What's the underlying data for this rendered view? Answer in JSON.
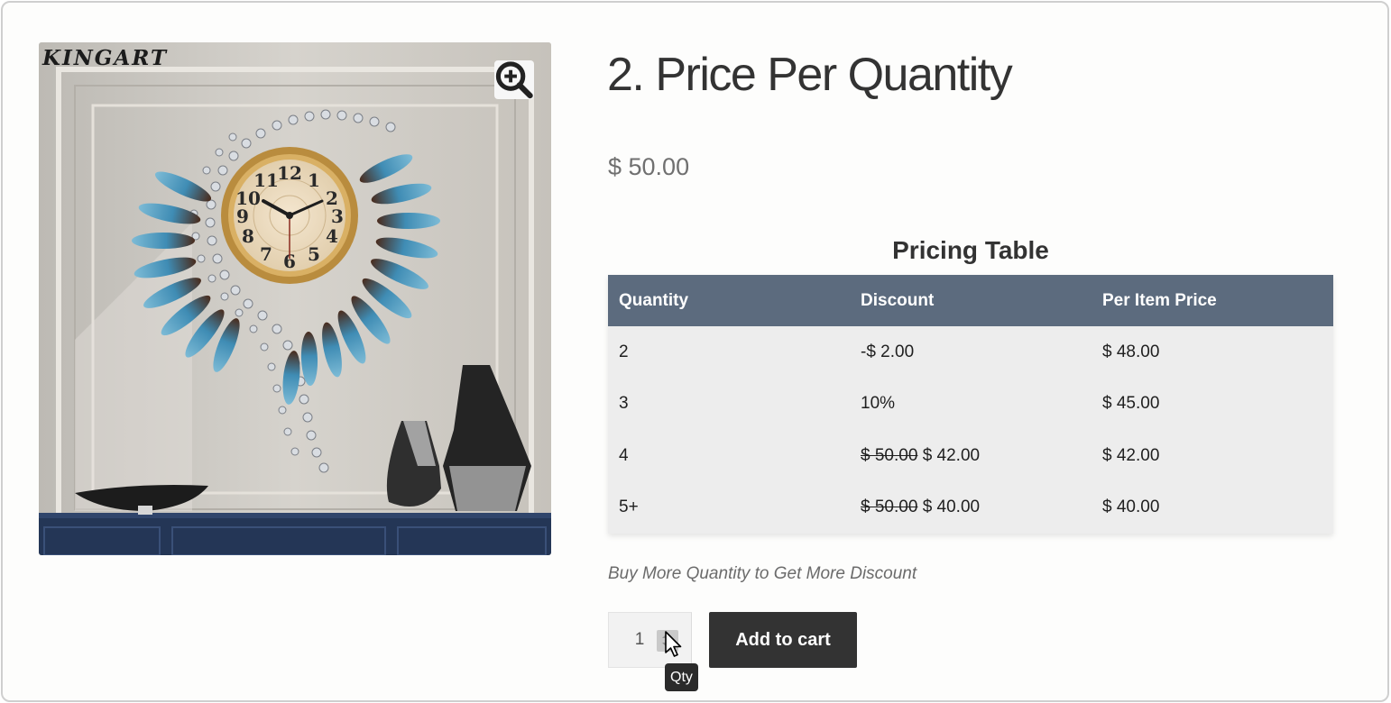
{
  "product": {
    "title": "2. Price Per Quantity",
    "price": "$ 50.00",
    "image": {
      "brand_mark": "KINGART",
      "zoom_icon": "zoom-in-icon"
    }
  },
  "pricing_table": {
    "title": "Pricing Table",
    "columns": [
      "Quantity",
      "Discount",
      "Per Item Price"
    ],
    "rows": [
      {
        "quantity": "2",
        "discount_old": "",
        "discount": "-$ 2.00",
        "per_item": "$ 48.00"
      },
      {
        "quantity": "3",
        "discount_old": "",
        "discount": "10%",
        "per_item": "$ 45.00"
      },
      {
        "quantity": "4",
        "discount_old": "$ 50.00",
        "discount": "$ 42.00",
        "per_item": "$ 42.00"
      },
      {
        "quantity": "5+",
        "discount_old": "$ 50.00",
        "discount": "$ 40.00",
        "per_item": "$ 40.00"
      }
    ]
  },
  "note": "Buy More Quantity to Get More Discount",
  "cart": {
    "quantity_value": "1",
    "quantity_tooltip": "Qty",
    "add_to_cart_label": "Add to cart"
  },
  "colors": {
    "table_header": "#5c6b7e",
    "table_body": "#ededed",
    "button": "#333333"
  }
}
